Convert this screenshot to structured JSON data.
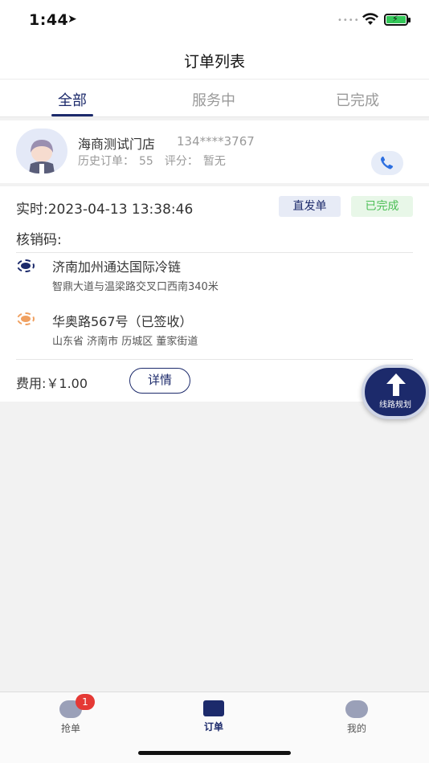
{
  "status_bar": {
    "time": "1:44"
  },
  "nav": {
    "title": "订单列表"
  },
  "tabs": [
    {
      "label": "全部",
      "active": true
    },
    {
      "label": "服务中",
      "active": false
    },
    {
      "label": "已完成",
      "active": false
    }
  ],
  "store": {
    "name": "海商测试门店",
    "phone": "134****3767",
    "history_label": "历史订单：",
    "history_count": "55",
    "rating_label": "评分：",
    "rating_value": "暂无"
  },
  "order": {
    "time": "实时:2023-04-13 13:38:46",
    "type_badge": "直发单",
    "status_badge": "已完成",
    "verify_label": "核销码:",
    "from_title": "济南加州通达国际冷链",
    "from_sub": "智鼎大道与温梁路交叉口西南340米",
    "to_title": "华奥路567号（已签收）",
    "to_sub": "山东省 济南市 历城区 董家街道",
    "fee": "费用:￥1.00",
    "detail_label": "详情"
  },
  "route_button": {
    "label": "线路规划"
  },
  "tab_bar": {
    "items": [
      {
        "label": "抢单",
        "active": false
      },
      {
        "label": "订单",
        "active": true
      },
      {
        "label": "我的",
        "active": false
      }
    ],
    "badge": "1"
  },
  "colors": {
    "primary": "#1c2a6b",
    "success": "#4cbf56",
    "accent": "#f0a060",
    "badge": "#e53935"
  }
}
